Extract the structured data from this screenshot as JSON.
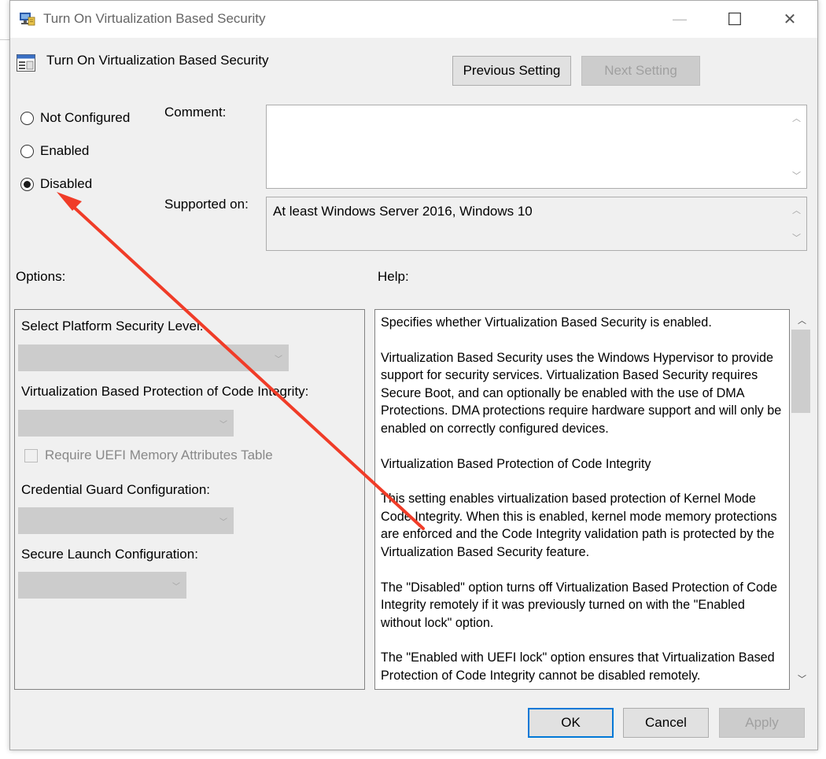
{
  "window": {
    "title": "Turn On Virtualization Based Security",
    "minimize_glyph": "—",
    "maximize_glyph": "☐",
    "close_glyph": "✕"
  },
  "header": {
    "title": "Turn On Virtualization Based Security",
    "icon": "policy-setting-icon"
  },
  "nav": {
    "previous": "Previous Setting",
    "next": "Next Setting"
  },
  "state": {
    "options": [
      "Not Configured",
      "Enabled",
      "Disabled"
    ],
    "selected": "Disabled"
  },
  "comment": {
    "label": "Comment:",
    "value": ""
  },
  "supported": {
    "label": "Supported on:",
    "value": "At least Windows Server 2016, Windows 10"
  },
  "sections": {
    "options": "Options:",
    "help": "Help:"
  },
  "options_panel": {
    "platform_security_label": "Select Platform Security Level:",
    "platform_security_value": "",
    "code_integrity_label": "Virtualization Based Protection of Code Integrity:",
    "code_integrity_value": "",
    "uefi_checkbox_label": "Require UEFI Memory Attributes Table",
    "uefi_checked": false,
    "credential_guard_label": "Credential Guard Configuration:",
    "credential_guard_value": "",
    "secure_launch_label": "Secure Launch Configuration:",
    "secure_launch_value": ""
  },
  "help": {
    "paragraphs": [
      "Specifies whether Virtualization Based Security is enabled.",
      "Virtualization Based Security uses the Windows Hypervisor to provide support for security services. Virtualization Based Security requires Secure Boot, and can optionally be enabled with the use of DMA Protections. DMA protections require hardware support and will only be enabled on correctly configured devices.",
      "Virtualization Based Protection of Code Integrity",
      "This setting enables virtualization based protection of Kernel Mode Code Integrity. When this is enabled, kernel mode memory protections are enforced and the Code Integrity validation path is protected by the Virtualization Based Security feature.",
      "The \"Disabled\" option turns off Virtualization Based Protection of Code Integrity remotely if it was previously turned on with the \"Enabled without lock\" option.",
      "The \"Enabled with UEFI lock\" option ensures that Virtualization Based Protection of Code Integrity cannot be disabled remotely."
    ]
  },
  "footer": {
    "ok": "OK",
    "cancel": "Cancel",
    "apply": "Apply"
  },
  "colors": {
    "annotation_arrow": "#f03c28",
    "default_button_border": "#0078d7"
  }
}
